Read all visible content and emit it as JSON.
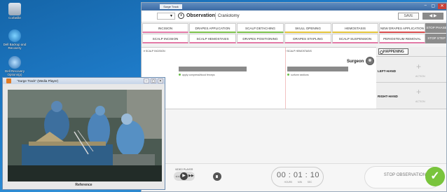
{
  "desktop": {
    "icons": [
      {
        "label": "Corbeille",
        "icon": "recycle-bin-icon"
      },
      {
        "label": "Dell Backup and\nRecovery",
        "icon": "backup-icon"
      },
      {
        "label": "Dell Recovery\nOptions(p)",
        "icon": "recovery-icon"
      }
    ]
  },
  "app": {
    "title": "Surge Track",
    "window_controls": {
      "minimize": "–",
      "maximize": "▢",
      "close": "✕"
    },
    "toolbar": {
      "selector_caret": "▼",
      "observation_label": "Observation",
      "observation_value": "Craniotomy",
      "save_label": "SAVE",
      "nav_label": "◀ ▶"
    },
    "phases_row1": [
      {
        "label": "INCISION",
        "accent": "pink"
      },
      {
        "label": "DRAPES APPLICATION",
        "accent": "green"
      },
      {
        "label": "SCALP DETACHING",
        "accent": "green"
      },
      {
        "label": "SKULL OPENING",
        "accent": "yellow"
      },
      {
        "label": "HEMOSTASIS",
        "accent": "yellow"
      },
      {
        "label": "NEW DRAPES APPLICATION",
        "accent": "red"
      }
    ],
    "phases_row2": [
      {
        "label": "SCALP INCISION",
        "accent": "pink"
      },
      {
        "label": "SCALP HEMOSTASIS",
        "accent": "pink"
      },
      {
        "label": "DRAPES POSITIONING",
        "accent": "pink"
      },
      {
        "label": "DRAPES STAPLING",
        "accent": "pink"
      },
      {
        "label": "SCALP SUSPENSION",
        "accent": "pink"
      },
      {
        "label": "PERIOSTEUM REMOVAL",
        "accent": "pink"
      }
    ],
    "stop_phase_label": "STOP PHASE",
    "stop_step_label": "STOP STEP",
    "timeline": {
      "marker1": "▾ SCALP INCISION",
      "marker2": "▾ SCALP HEMOSTASIS",
      "note1": "apply compress/blood ferceps",
      "note2": "surform sections",
      "surgeon_label": "Surgeon"
    },
    "happening": {
      "label": "HAPPENING",
      "left_hand_label": "LEFT-HAND",
      "right_hand_label": "RIGHT-HAND",
      "action_label": "ACTION",
      "plus": "+"
    },
    "player": {
      "label": "VIDEO PLAYER",
      "rewind": "◀◀",
      "play": "▶",
      "forward": "▶▶"
    },
    "timer": {
      "value": "00 : 01 : 10",
      "units": "HOURS MIN SEC"
    },
    "stop_observation_label": "STOP OBSERVATION",
    "check": "✓"
  },
  "media_player": {
    "title": "\"Surge Track\" (Media Player)",
    "caption": "Reference"
  },
  "colors": {
    "pink": "#e37aa7",
    "green": "#7cc24a",
    "yellow": "#e5c43a",
    "red": "#d94b4b",
    "confirm": "#79c43c"
  }
}
